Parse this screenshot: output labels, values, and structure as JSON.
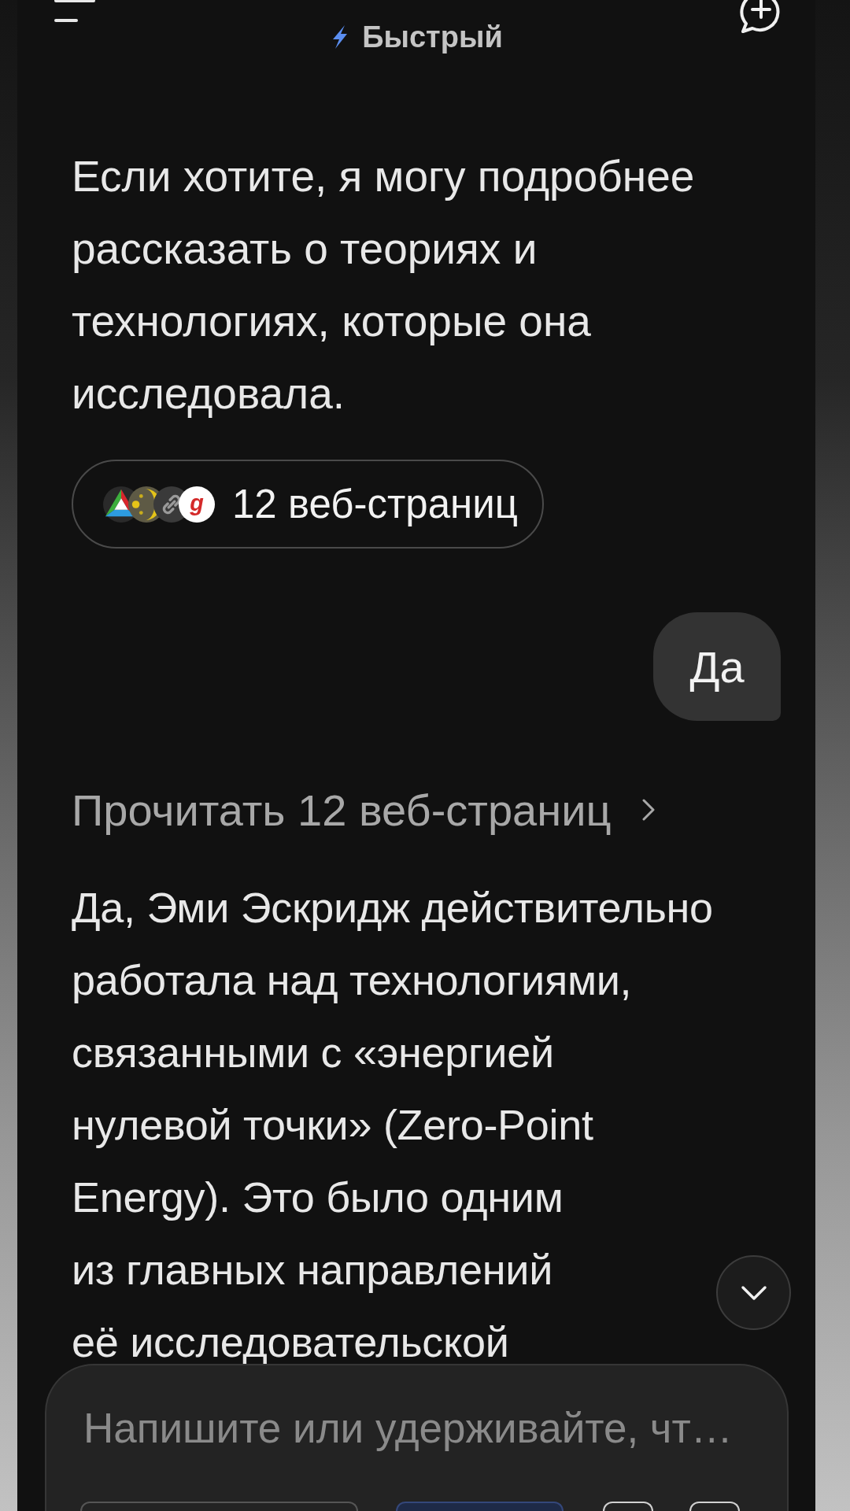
{
  "header": {
    "mode_label": "Быстрый"
  },
  "messages": [
    {
      "kind": "assistant_text",
      "lines": [
        "Если хотите, я могу подробнее",
        "рассказать о теориях и",
        "технологиях, которые она",
        "исследовала."
      ]
    },
    {
      "kind": "sources",
      "count_label": "12 веб-страниц",
      "favicons": [
        {
          "kind": "triangle"
        },
        {
          "kind": "moon"
        },
        {
          "kind": "link"
        },
        {
          "kind": "letter",
          "letter": "g"
        }
      ]
    },
    {
      "kind": "user",
      "text": "Да"
    },
    {
      "kind": "read_link",
      "text": "Прочитать 12 веб-страниц"
    },
    {
      "kind": "assistant_text",
      "lines": [
        "Да, Эми Эскридж действительно",
        "работала над технологиями,",
        "связанными с «энергией",
        "нулевой точки» (Zero-Point",
        "Energy). Это было одним",
        "из главных направлений",
        "её исследовательской"
      ]
    }
  ],
  "composer": {
    "placeholder": "Напишите или удерживайте, чт…",
    "chips": [
      {
        "kind": "outline"
      },
      {
        "kind": "accent"
      },
      {
        "kind": "round"
      },
      {
        "kind": "round"
      }
    ]
  }
}
